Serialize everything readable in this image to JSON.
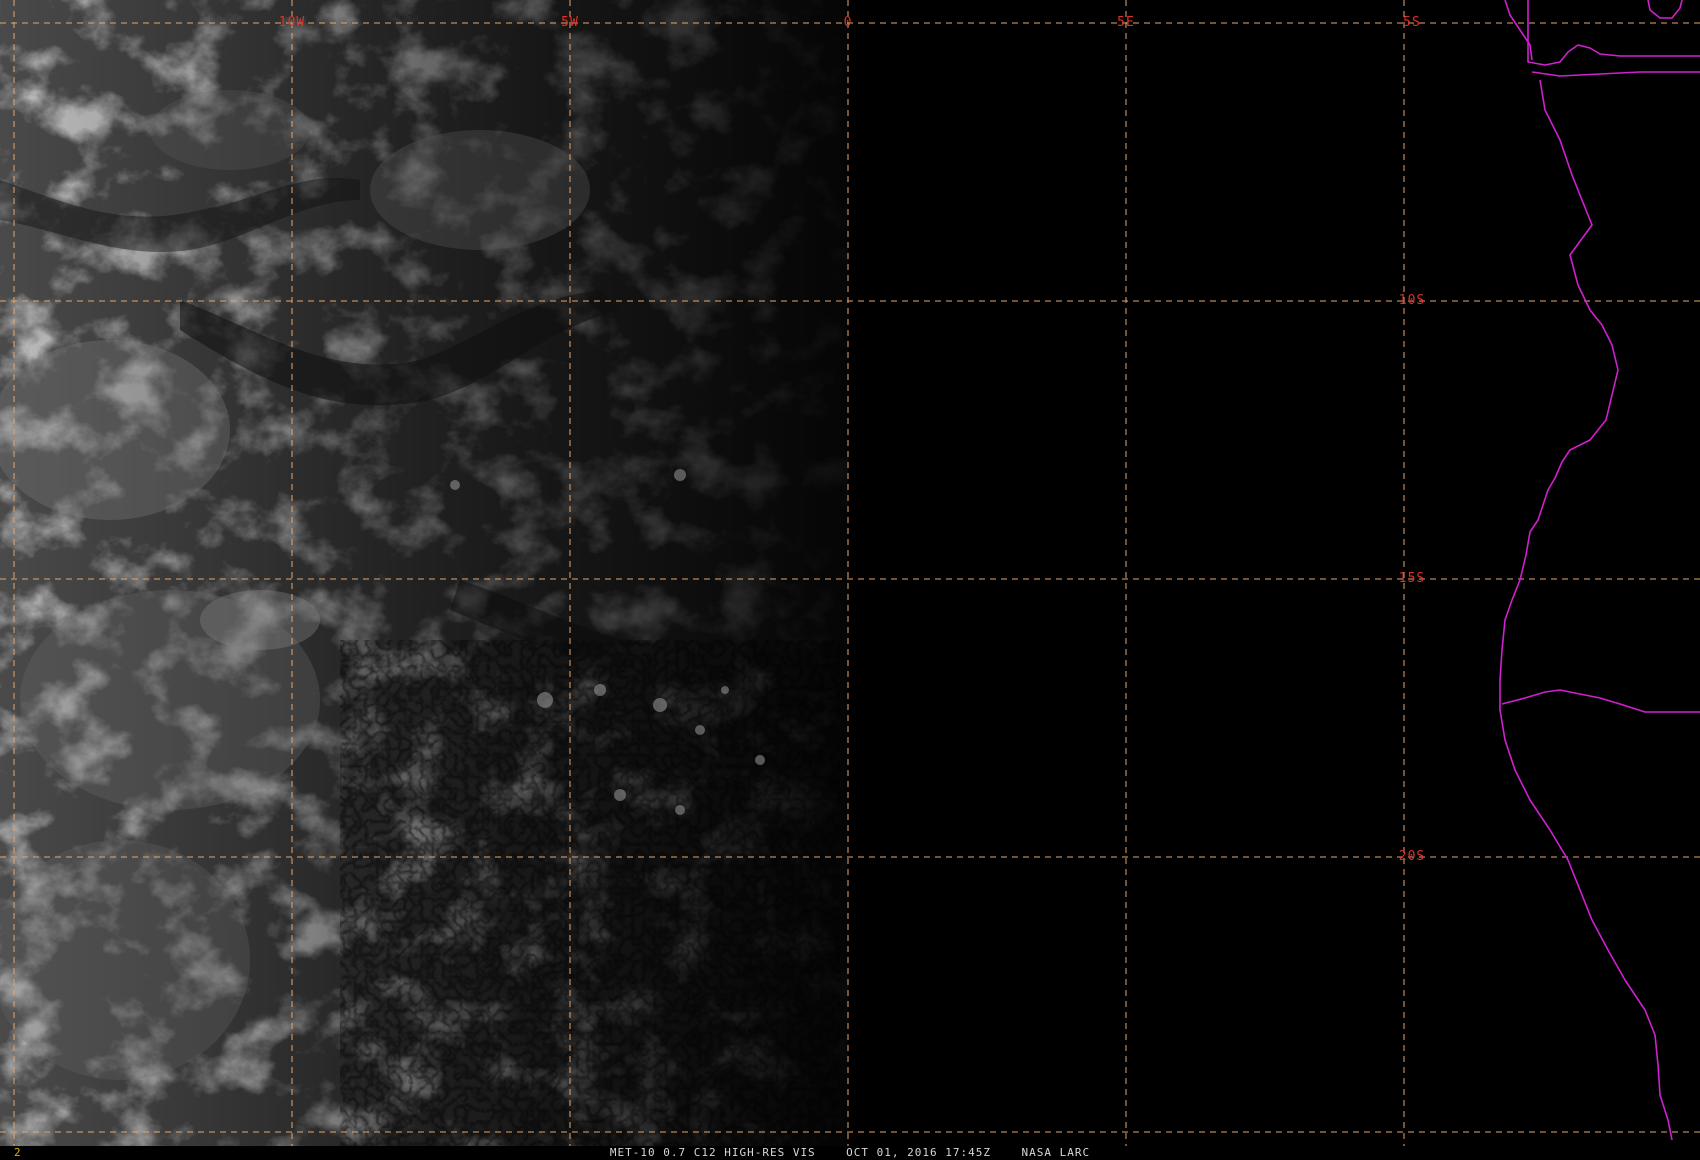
{
  "product": {
    "caption": "MET-10 0.7 C12 HIGH-RES VIS    OCT 01, 2016 17:45Z    NASA LARC",
    "frame_number": "2"
  },
  "grid": {
    "line_color": "#e6a66a",
    "label_color": "#d8322a",
    "longitudes": [
      {
        "label": "10W",
        "value": -10
      },
      {
        "label": "5W",
        "value": -5
      },
      {
        "label": "0",
        "value": 0
      },
      {
        "label": "5E",
        "value": 5
      }
    ],
    "latitudes": [
      {
        "label": "5S",
        "value": -5
      },
      {
        "label": "10S",
        "value": -10
      },
      {
        "label": "15S",
        "value": -15
      },
      {
        "label": "20S",
        "value": -20
      }
    ]
  },
  "map": {
    "coastline_color": "#d020d0",
    "terminator_longitude": 0
  }
}
